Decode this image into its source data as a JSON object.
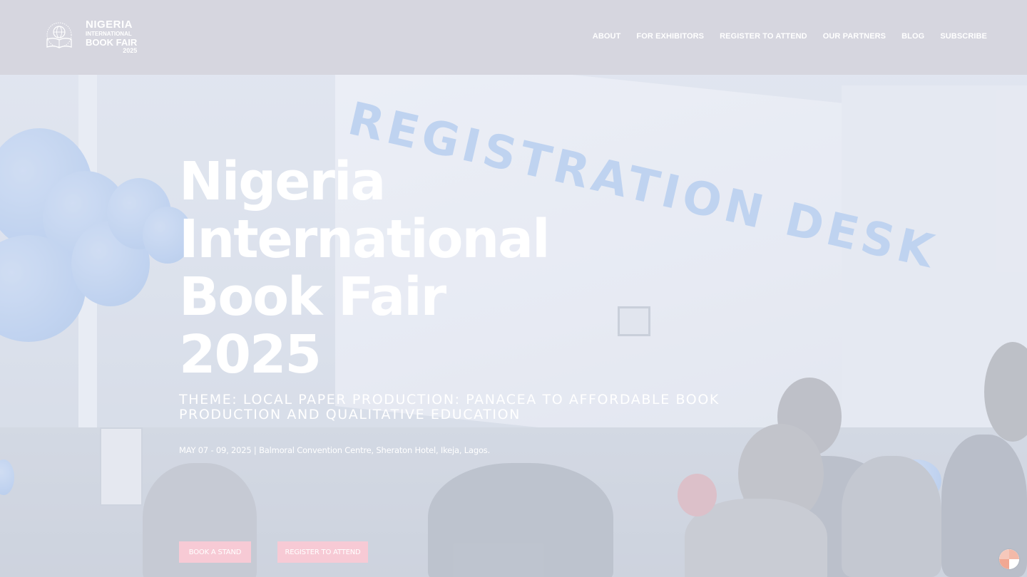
{
  "header": {
    "logo": {
      "line1": "NIGERIA",
      "line2": "INTERNATIONAL",
      "line3": "BOOK FAIR",
      "line4": "2025"
    },
    "nav": [
      {
        "label": "ABOUT"
      },
      {
        "label": "FOR EXHIBITORS"
      },
      {
        "label": "REGISTER TO ATTEND"
      },
      {
        "label": "OUR PARTNERS"
      },
      {
        "label": "BLOG"
      },
      {
        "label": "SUBSCRIBE"
      }
    ]
  },
  "hero": {
    "background_sign": "REGISTRATION DESK",
    "title_lines": [
      "Nigeria",
      "International",
      "Book Fair",
      "2025"
    ],
    "theme": "THEME: LOCAL PAPER PRODUCTION: PANACEA TO AFFORDABLE BOOK PRODUCTION AND QUALITATIVE EDUCATION",
    "date_venue": "MAY 07 - 09, 2025 | Balmoral Convention Centre, Sheraton Hotel, Ikeja, Lagos.",
    "buttons": {
      "book_stand": "BOOK A STAND",
      "register": "REGISTER TO ATTEND"
    }
  },
  "colors": {
    "header_bg": "#d6d6df",
    "button_bg": "#f7cad5",
    "sign_text": "#a9c6ee"
  },
  "icons": {
    "logo_emblem": "globe-book-emblem-icon",
    "chat": "chat-widget-icon"
  }
}
